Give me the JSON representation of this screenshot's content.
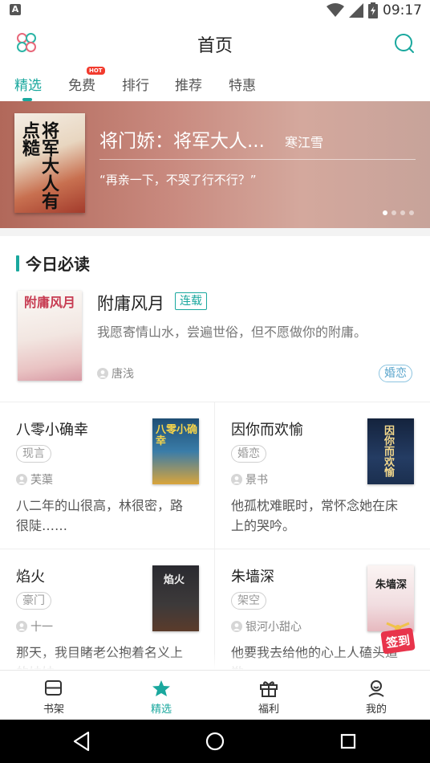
{
  "status_bar": {
    "left_icon": "A",
    "time": "09:17"
  },
  "header": {
    "title": "首页"
  },
  "tabs": [
    {
      "label": "精选",
      "active": true
    },
    {
      "label": "免费",
      "badge": "HOT"
    },
    {
      "label": "排行"
    },
    {
      "label": "推荐"
    },
    {
      "label": "特惠"
    }
  ],
  "banner": {
    "cover_text": "将军大人有点糙",
    "title": "将门娇：将军大人...",
    "author": "寒江雪",
    "quote": "“再亲一下，不哭了行不行？”",
    "pages": 4,
    "current_page": 1
  },
  "section": {
    "title": "今日必读"
  },
  "featured": {
    "cover_text": "附庸风月",
    "title": "附庸风月",
    "status_tag": "连载",
    "description": "我愿寄情山水，尝遍世俗，但不愿做你的附庸。",
    "author": "唐浅",
    "genre": "婚恋"
  },
  "books": [
    {
      "title": "八零小确幸",
      "genre": "现言",
      "author": "芙蕖",
      "description": "八二年的山很高，林很密，路很陡……",
      "cover_text": "八零小确幸",
      "cover_color": "#2a5f86"
    },
    {
      "title": "因你而欢愉",
      "genre": "婚恋",
      "author": "景书",
      "description": "他孤枕难眠时，常怀念她在床上的哭吟。",
      "cover_text": "因你而欢愉",
      "cover_color": "#1b2f4f"
    },
    {
      "title": "焰火",
      "genre": "豪门",
      "author": "十一",
      "description": "那天，我目睹老公抱着名义上的妹妹",
      "cover_text": "焰火",
      "cover_color": "#2b2a2f"
    },
    {
      "title": "朱墙深",
      "genre": "架空",
      "author": "银河小甜心",
      "description": "他要我去给他的心上人磕头道歉",
      "cover_text": "朱墙深",
      "cover_color": "#f1dde0"
    }
  ],
  "signin_badge": {
    "label": "签到"
  },
  "bottom_nav": [
    {
      "label": "书架",
      "icon": "bookshelf-icon"
    },
    {
      "label": "精选",
      "icon": "star-icon",
      "active": true
    },
    {
      "label": "福利",
      "icon": "gift-icon"
    },
    {
      "label": "我的",
      "icon": "user-icon"
    }
  ],
  "colors": {
    "accent": "#1aa89e",
    "hot": "#f23b2e",
    "signin": "#e8344b"
  }
}
